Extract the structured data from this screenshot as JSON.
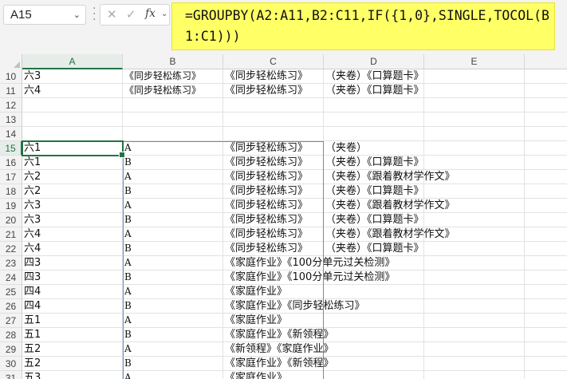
{
  "formula_bar": {
    "name_box": "A15",
    "cancel_icon": "✕",
    "enter_icon": "✓",
    "fx_label": "fx",
    "formula": "=GROUPBY(A2:A11,B2:C11,IF({1,0},SINGLE,TOCOL(B1:C1)))"
  },
  "columns": [
    "A",
    "B",
    "C",
    "D",
    "E"
  ],
  "active_cell": "A15",
  "rows": [
    {
      "num": "10",
      "A": "六3",
      "B": "《同步轻松练习》",
      "C": "《同步轻松练习》",
      "D": "（夹卷）《口算题卡》",
      "E": ""
    },
    {
      "num": "11",
      "A": "六4",
      "B": "《同步轻松练习》",
      "C": "《同步轻松练习》",
      "D": "（夹卷）《口算题卡》",
      "E": ""
    },
    {
      "num": "12",
      "A": "",
      "B": "",
      "C": "",
      "D": "",
      "E": ""
    },
    {
      "num": "13",
      "A": "",
      "B": "",
      "C": "",
      "D": "",
      "E": ""
    },
    {
      "num": "14",
      "A": "",
      "B": "",
      "C": "",
      "D": "",
      "E": ""
    },
    {
      "num": "15",
      "A": "六1",
      "B": "A",
      "C": "《同步轻松练习》",
      "D": "（夹卷）",
      "E": ""
    },
    {
      "num": "16",
      "A": "六1",
      "B": "B",
      "C": "《同步轻松练习》",
      "D": "（夹卷）《口算题卡》",
      "E": ""
    },
    {
      "num": "17",
      "A": "六2",
      "B": "A",
      "C": "《同步轻松练习》",
      "D": "（夹卷）《跟着教材学作文》",
      "E": ""
    },
    {
      "num": "18",
      "A": "六2",
      "B": "B",
      "C": "《同步轻松练习》",
      "D": "（夹卷）《口算题卡》",
      "E": ""
    },
    {
      "num": "19",
      "A": "六3",
      "B": "A",
      "C": "《同步轻松练习》",
      "D": "（夹卷）《跟着教材学作文》",
      "E": ""
    },
    {
      "num": "20",
      "A": "六3",
      "B": "B",
      "C": "《同步轻松练习》",
      "D": "（夹卷）《口算题卡》",
      "E": ""
    },
    {
      "num": "21",
      "A": "六4",
      "B": "A",
      "C": "《同步轻松练习》",
      "D": "（夹卷）《跟着教材学作文》",
      "E": ""
    },
    {
      "num": "22",
      "A": "六4",
      "B": "B",
      "C": "《同步轻松练习》",
      "D": "（夹卷）《口算题卡》",
      "E": ""
    },
    {
      "num": "23",
      "A": "四3",
      "B": "A",
      "C": "《家庭作业》《100分单元过关检测》",
      "D": "",
      "E": ""
    },
    {
      "num": "24",
      "A": "四3",
      "B": "B",
      "C": "《家庭作业》《100分单元过关检测》",
      "D": "",
      "E": ""
    },
    {
      "num": "25",
      "A": "四4",
      "B": "A",
      "C": "《家庭作业》",
      "D": "",
      "E": ""
    },
    {
      "num": "26",
      "A": "四4",
      "B": "B",
      "C": "《家庭作业》《同步轻松练习》",
      "D": "",
      "E": ""
    },
    {
      "num": "27",
      "A": "五1",
      "B": "A",
      "C": "《家庭作业》",
      "D": "",
      "E": ""
    },
    {
      "num": "28",
      "A": "五1",
      "B": "B",
      "C": "《家庭作业》《新领程》",
      "D": "",
      "E": ""
    },
    {
      "num": "29",
      "A": "五2",
      "B": "A",
      "C": "《新领程》《家庭作业》",
      "D": "",
      "E": ""
    },
    {
      "num": "30",
      "A": "五2",
      "B": "B",
      "C": "《家庭作业》《新领程》",
      "D": "",
      "E": ""
    },
    {
      "num": "31",
      "A": "五3",
      "B": "A",
      "C": "《家庭作业》",
      "D": "",
      "E": ""
    }
  ]
}
